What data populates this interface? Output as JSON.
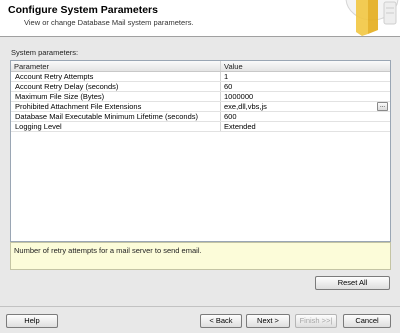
{
  "header": {
    "title": "Configure System Parameters",
    "subtitle": "View or change Database Mail system parameters."
  },
  "section_label": "System parameters:",
  "grid": {
    "columns": [
      "Parameter",
      "Value"
    ],
    "rows": [
      {
        "parameter": "Account Retry Attempts",
        "value": "1"
      },
      {
        "parameter": "Account Retry Delay (seconds)",
        "value": "60"
      },
      {
        "parameter": "Maximum File Size (Bytes)",
        "value": "1000000"
      },
      {
        "parameter": "Prohibited Attachment File Extensions",
        "value": "exe,dll,vbs,js"
      },
      {
        "parameter": "Database Mail Executable Minimum Lifetime (seconds)",
        "value": "600"
      },
      {
        "parameter": "Logging Level",
        "value": "Extended"
      }
    ],
    "ellipsis_label": "..."
  },
  "description": "Number of retry attempts for a mail server to send email.",
  "buttons": {
    "reset_all": "Reset All",
    "help": "Help",
    "back": "< Back",
    "next": "Next >",
    "finish": "Finish >>|",
    "cancel": "Cancel"
  },
  "colors": {
    "header_bg": "#ffffff",
    "dialog_bg": "#e8e8e8",
    "description_bg": "#fcfcd9",
    "icon_accent": "#f2c641"
  }
}
